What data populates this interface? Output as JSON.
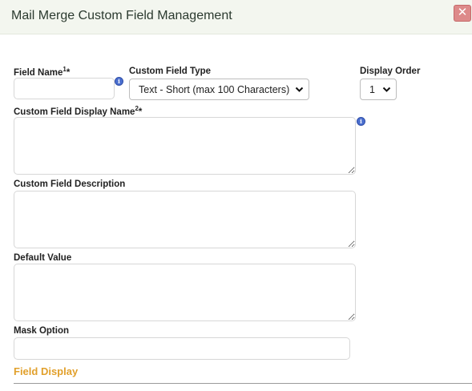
{
  "dialog": {
    "title": "Mail Merge Custom Field Management",
    "close_label": "✕"
  },
  "form": {
    "field_name": {
      "label": "Field Name",
      "sup": "1",
      "required": "*",
      "value": ""
    },
    "custom_field_type": {
      "label": "Custom Field Type",
      "selected": "Text - Short (max 100 Characters)"
    },
    "display_order": {
      "label": "Display Order",
      "selected": "1"
    },
    "display_name": {
      "label": "Custom Field Display Name",
      "sup": "2",
      "required": "*",
      "value": ""
    },
    "description": {
      "label": "Custom Field Description",
      "value": ""
    },
    "default_value": {
      "label": "Default Value",
      "value": ""
    },
    "mask_option": {
      "label": "Mask Option",
      "value": ""
    }
  },
  "section": {
    "title": "Field Display"
  },
  "icons": {
    "info": "i",
    "chevron": "chevron-down-icon"
  },
  "colors": {
    "accent": "#e1a02c",
    "header_bg": "#f3f6ef",
    "close_bg": "#dd8a8a",
    "info_icon": "#4b6fcf"
  }
}
